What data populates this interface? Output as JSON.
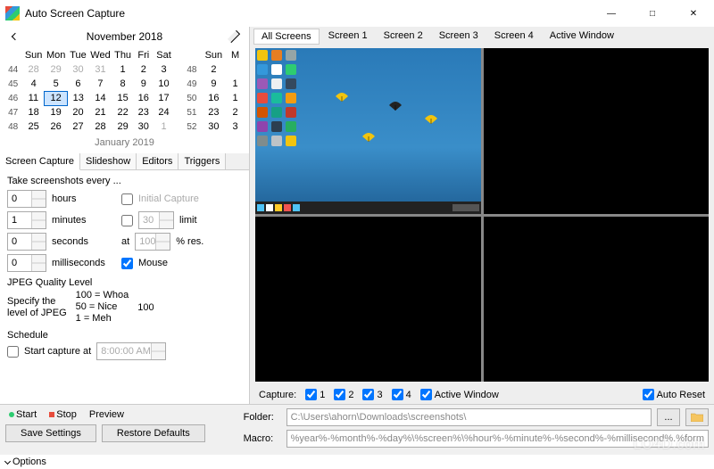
{
  "window": {
    "title": "Auto Screen Capture"
  },
  "calendar": {
    "month_label": "November 2018",
    "next_month_label": "January 2019",
    "dow": [
      "Sun",
      "Mon",
      "Tue",
      "Wed",
      "Thu",
      "Fri",
      "Sat"
    ],
    "dow2": [
      "Sun",
      "M"
    ],
    "weeks": [
      {
        "wk": "44",
        "d": [
          "28",
          "29",
          "30",
          "31",
          "1",
          "2",
          "3"
        ]
      },
      {
        "wk": "45",
        "d": [
          "4",
          "5",
          "6",
          "7",
          "8",
          "9",
          "10"
        ]
      },
      {
        "wk": "46",
        "d": [
          "11",
          "12",
          "13",
          "14",
          "15",
          "16",
          "17"
        ]
      },
      {
        "wk": "47",
        "d": [
          "18",
          "19",
          "20",
          "21",
          "22",
          "23",
          "24"
        ]
      },
      {
        "wk": "48",
        "d": [
          "25",
          "26",
          "27",
          "28",
          "29",
          "30",
          "1"
        ]
      }
    ],
    "weeks2": [
      {
        "wk": "48",
        "d": [
          "2"
        ]
      },
      {
        "wk": "49",
        "d": [
          "9",
          "1"
        ]
      },
      {
        "wk": "50",
        "d": [
          "16",
          "1"
        ]
      },
      {
        "wk": "51",
        "d": [
          "23",
          "2"
        ]
      },
      {
        "wk": "52",
        "d": [
          "30",
          "3"
        ]
      }
    ],
    "selected": "12"
  },
  "settings_tabs": {
    "t0": "Screen Capture",
    "t1": "Slideshow",
    "t2": "Editors",
    "t3": "Triggers"
  },
  "capture": {
    "heading": "Take screenshots every ...",
    "hours": "0",
    "hours_label": "hours",
    "initial_capture_label": "Initial Capture",
    "minutes": "1",
    "minutes_label": "minutes",
    "limit_value": "30",
    "limit_label": "limit",
    "seconds": "0",
    "seconds_label": "seconds",
    "res_prefix": "at",
    "res_value": "100",
    "res_suffix": "% res.",
    "ms": "0",
    "ms_label": "milliseconds",
    "mouse_label": "Mouse",
    "jpeg_title": "JPEG Quality Level",
    "jpeg_line1": "Specify the",
    "jpeg_line2": "level of JPEG",
    "jpeg_100": "100 = Whoa",
    "jpeg_50": "50 = Nice",
    "jpeg_1": "1 = Meh",
    "jpeg_value": "100",
    "schedule_title": "Schedule",
    "schedule_start_label": "Start capture at",
    "schedule_start_time": "8:00:00 AM"
  },
  "view_tabs": {
    "all": "All Screens",
    "s1": "Screen 1",
    "s2": "Screen 2",
    "s3": "Screen 3",
    "s4": "Screen 4",
    "aw": "Active Window"
  },
  "capture_row": {
    "label": "Capture:",
    "c1": "1",
    "c2": "2",
    "c3": "3",
    "c4": "4",
    "cw": "Active Window",
    "ar": "Auto Reset"
  },
  "toolbar": {
    "start": "Start",
    "stop": "Stop",
    "preview": "Preview",
    "save": "Save Settings",
    "restore": "Restore Defaults"
  },
  "paths": {
    "folder_label": "Folder:",
    "folder_value": "C:\\Users\\ahorn\\Downloads\\screenshots\\",
    "macro_label": "Macro:",
    "macro_value": "%year%-%month%-%day%\\%screen%\\%hour%-%minute%-%second%-%millisecond%.%form",
    "browse": "..."
  },
  "options_label": "Options",
  "watermark": "LO4D.com"
}
